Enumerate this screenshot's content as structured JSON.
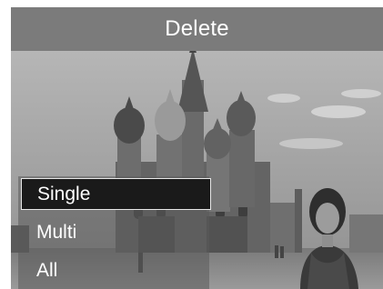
{
  "title": "Delete",
  "menu": {
    "items": [
      {
        "label": "Single",
        "selected": true
      },
      {
        "label": "Multi",
        "selected": false
      },
      {
        "label": "All",
        "selected": false
      }
    ]
  },
  "colors": {
    "title_bar": "#7b7b7b",
    "menu_panel": "#5a5a5a",
    "selected_item": "#1a1a1a",
    "text": "#ffffff"
  }
}
